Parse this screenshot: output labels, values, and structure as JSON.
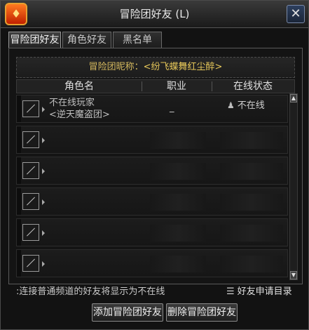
{
  "window": {
    "title": "冒险团好友 (L)",
    "close_label": "✕"
  },
  "tabs": [
    {
      "label": "冒险团好友",
      "active": true
    },
    {
      "label": "角色好友",
      "active": false
    },
    {
      "label": "黑名单",
      "active": false
    }
  ],
  "nickname": {
    "label": "冒险团昵称：",
    "value": "<纷飞蝶舞红尘醉>"
  },
  "table": {
    "headers": [
      "角色名",
      "职业",
      "在线状态"
    ],
    "rows": [
      {
        "name_line1": "不在线玩家",
        "name_line2": "<逆天魔盗团>",
        "job": "_",
        "status": "不在线"
      },
      {
        "name_line1": "",
        "name_line2": "",
        "job": "",
        "status": ""
      },
      {
        "name_line1": "",
        "name_line2": "",
        "job": "",
        "status": ""
      },
      {
        "name_line1": "",
        "name_line2": "",
        "job": "",
        "status": ""
      },
      {
        "name_line1": "",
        "name_line2": "",
        "job": "",
        "status": ""
      },
      {
        "name_line1": "",
        "name_line2": "",
        "job": "",
        "status": ""
      }
    ]
  },
  "footer": {
    "note": ":连接普通频道的好友将显示为不在线",
    "link_label": "好友申请目录"
  },
  "buttons": {
    "add": "添加冒险团好友",
    "delete": "删除冒险团好友"
  },
  "colors": {
    "gold": "#e8c95a",
    "window_bg": "#121212",
    "logo": "#e04810"
  },
  "icons": [
    "game-logo-icon",
    "close-icon",
    "avatar-icon",
    "expand-arrow-icon",
    "person-icon",
    "scroll-up-icon",
    "scroll-down-icon",
    "list-icon"
  ]
}
